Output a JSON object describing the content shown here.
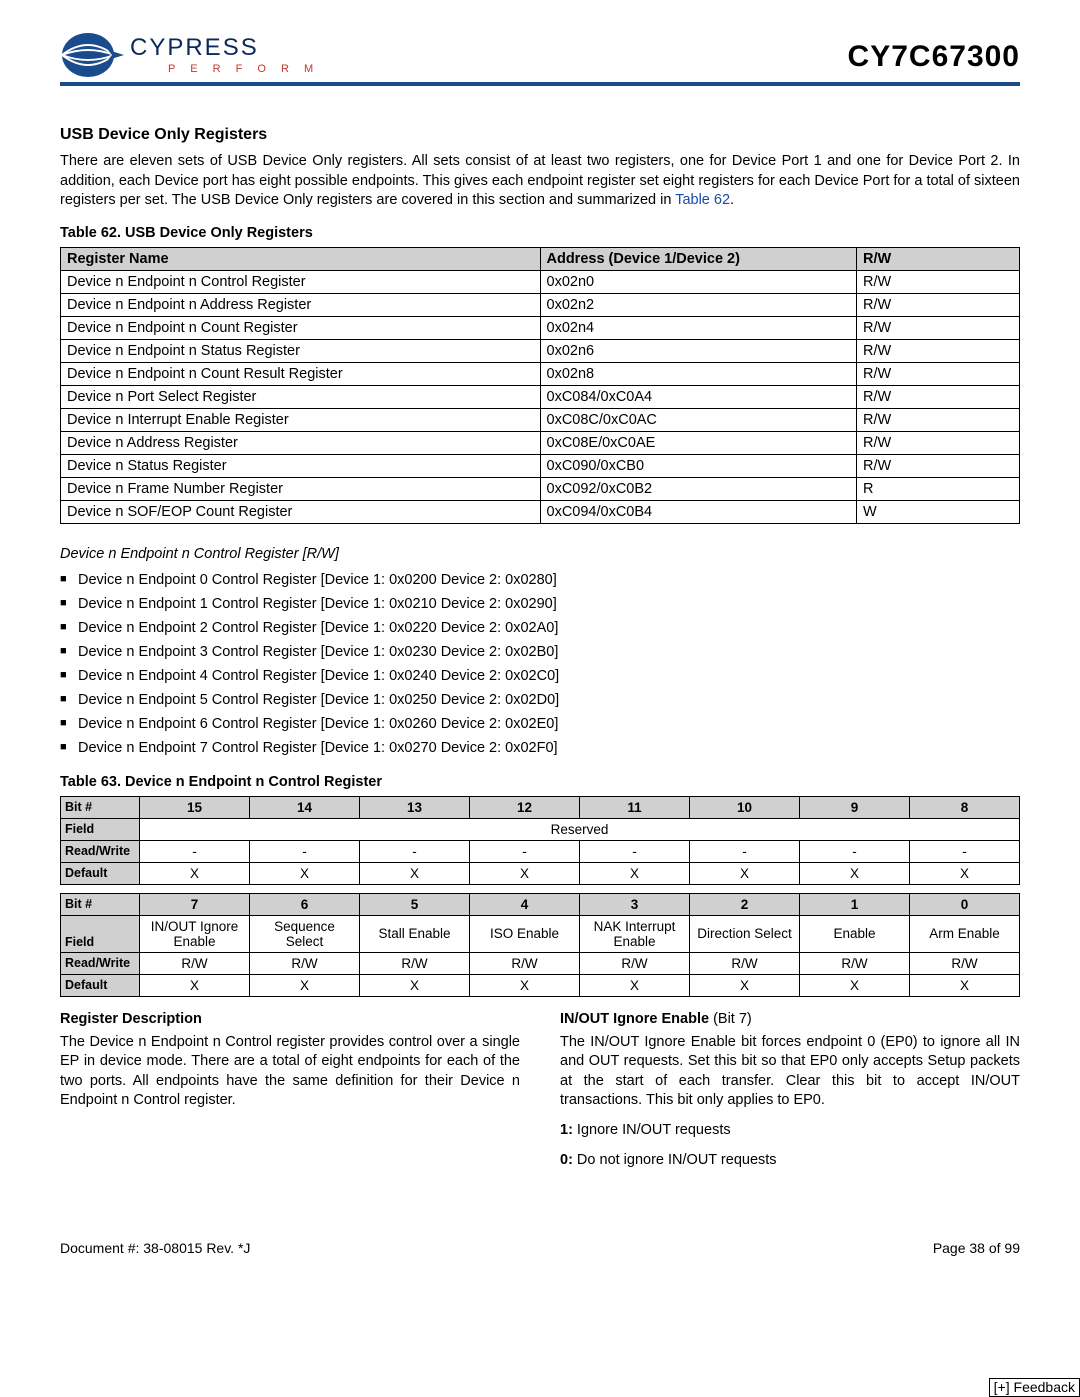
{
  "header": {
    "logo_name": "CYPRESS",
    "logo_tag": "P E R F O R M",
    "part_number": "CY7C67300"
  },
  "section": {
    "title": "USB Device Only Registers",
    "intro": "There are eleven sets of USB Device Only registers. All sets consist of at least two registers, one for Device Port 1 and one for Device Port 2. In addition, each Device port has eight possible endpoints. This gives each endpoint register set eight registers for each Device Port for a total of sixteen registers per set. The USB Device Only registers are covered in this section and summarized in ",
    "intro_link": "Table 62",
    "intro_end": "."
  },
  "table62": {
    "caption": "Table 62.  USB Device Only Registers",
    "headers": [
      "Register Name",
      "Address (Device 1/Device 2)",
      "R/W"
    ],
    "rows": [
      [
        "Device n Endpoint n Control Register",
        "0x02n0",
        "R/W"
      ],
      [
        "Device n Endpoint n Address Register",
        "0x02n2",
        "R/W"
      ],
      [
        "Device n Endpoint n Count Register",
        "0x02n4",
        "R/W"
      ],
      [
        "Device n Endpoint n Status Register",
        "0x02n6",
        "R/W"
      ],
      [
        "Device n Endpoint n Count Result Register",
        "0x02n8",
        "R/W"
      ],
      [
        "Device n Port Select Register",
        "0xC084/0xC0A4",
        "R/W"
      ],
      [
        "Device n Interrupt Enable Register",
        "0xC08C/0xC0AC",
        "R/W"
      ],
      [
        "Device n Address Register",
        "0xC08E/0xC0AE",
        "R/W"
      ],
      [
        "Device n Status Register",
        "0xC090/0xCB0",
        "R/W"
      ],
      [
        "Device n Frame Number Register",
        "0xC092/0xC0B2",
        "R"
      ],
      [
        "Device n SOF/EOP Count Register",
        "0xC094/0xC0B4",
        "W"
      ]
    ]
  },
  "subheading": "Device n Endpoint n Control Register [R/W]",
  "bullets": [
    "Device n Endpoint 0 Control Register [Device 1: 0x0200 Device 2: 0x0280]",
    "Device n Endpoint 1 Control Register [Device 1: 0x0210 Device 2: 0x0290]",
    "Device n Endpoint 2 Control Register [Device 1: 0x0220 Device 2: 0x02A0]",
    "Device n Endpoint 3 Control Register [Device 1: 0x0230 Device 2: 0x02B0]",
    "Device n Endpoint 4 Control Register [Device 1: 0x0240 Device 2: 0x02C0]",
    "Device n Endpoint 5 Control Register [Device 1: 0x0250 Device 2: 0x02D0]",
    "Device n Endpoint 6 Control Register [Device 1: 0x0260 Device 2: 0x02E0]",
    "Device n Endpoint 7 Control Register [Device 1: 0x0270 Device 2: 0x02F0]"
  ],
  "table63": {
    "caption": "Table 63.  Device n Endpoint n Control Register",
    "upper": {
      "bits": [
        "15",
        "14",
        "13",
        "12",
        "11",
        "10",
        "9",
        "8"
      ],
      "field": "Reserved",
      "rw": [
        "-",
        "-",
        "-",
        "-",
        "-",
        "-",
        "-",
        "-"
      ],
      "def": [
        "X",
        "X",
        "X",
        "X",
        "X",
        "X",
        "X",
        "X"
      ]
    },
    "lower": {
      "bits": [
        "7",
        "6",
        "5",
        "4",
        "3",
        "2",
        "1",
        "0"
      ],
      "fields": [
        "IN/OUT Ignore Enable",
        "Sequence Select",
        "Stall Enable",
        "ISO Enable",
        "NAK Interrupt Enable",
        "Direction Select",
        "Enable",
        "Arm Enable"
      ],
      "rw": [
        "R/W",
        "R/W",
        "R/W",
        "R/W",
        "R/W",
        "R/W",
        "R/W",
        "R/W"
      ],
      "def": [
        "X",
        "X",
        "X",
        "X",
        "X",
        "X",
        "X",
        "X"
      ]
    },
    "row_labels": {
      "bit": "Bit #",
      "field": "Field",
      "rw": "Read/Write",
      "def": "Default"
    }
  },
  "descriptions": {
    "left": {
      "title": "Register Description",
      "text": "The Device n Endpoint n Control register provides control over a single EP in device mode. There are a total of eight endpoints for each of the two ports. All endpoints have the same definition for their Device n Endpoint n Control register."
    },
    "right": {
      "title_prefix": "IN/OUT Ignore Enable",
      "title_suffix": " (Bit 7)",
      "text": "The IN/OUT Ignore Enable bit forces endpoint 0 (EP0) to ignore all IN and OUT requests. Set this bit so that EP0 only accepts Setup packets at the start of each transfer. Clear this bit to accept IN/OUT transactions. This bit only applies to EP0.",
      "opt1_b": "1:",
      "opt1_t": " Ignore IN/OUT requests",
      "opt0_b": "0:",
      "opt0_t": " Do not ignore IN/OUT requests"
    }
  },
  "footer": {
    "doc": "Document #: 38-08015 Rev. *J",
    "page": "Page 38 of 99",
    "feedback": "[+] Feedback"
  }
}
